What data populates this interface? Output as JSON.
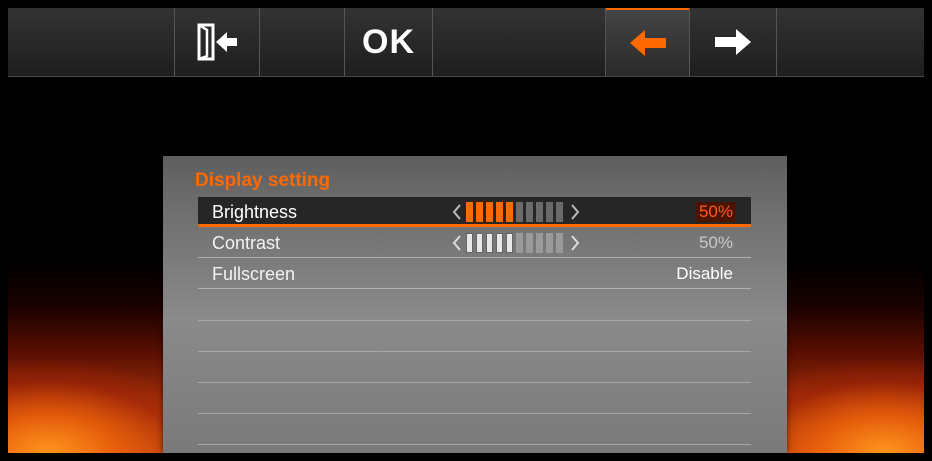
{
  "toolbar": {
    "ok_label": "OK",
    "icons": [
      "exit-door-icon",
      "arrow-left-icon",
      "arrow-right-icon"
    ],
    "accent_color": "#ff6a00"
  },
  "panel": {
    "title": "Display setting",
    "rows": [
      {
        "label": "Brightness",
        "value": "50%",
        "level": 0.5,
        "selected": true
      },
      {
        "label": "Contrast",
        "value": "50%",
        "level": 0.5,
        "selected": false
      },
      {
        "label": "Fullscreen",
        "value": "Disable",
        "selected": false
      }
    ]
  }
}
